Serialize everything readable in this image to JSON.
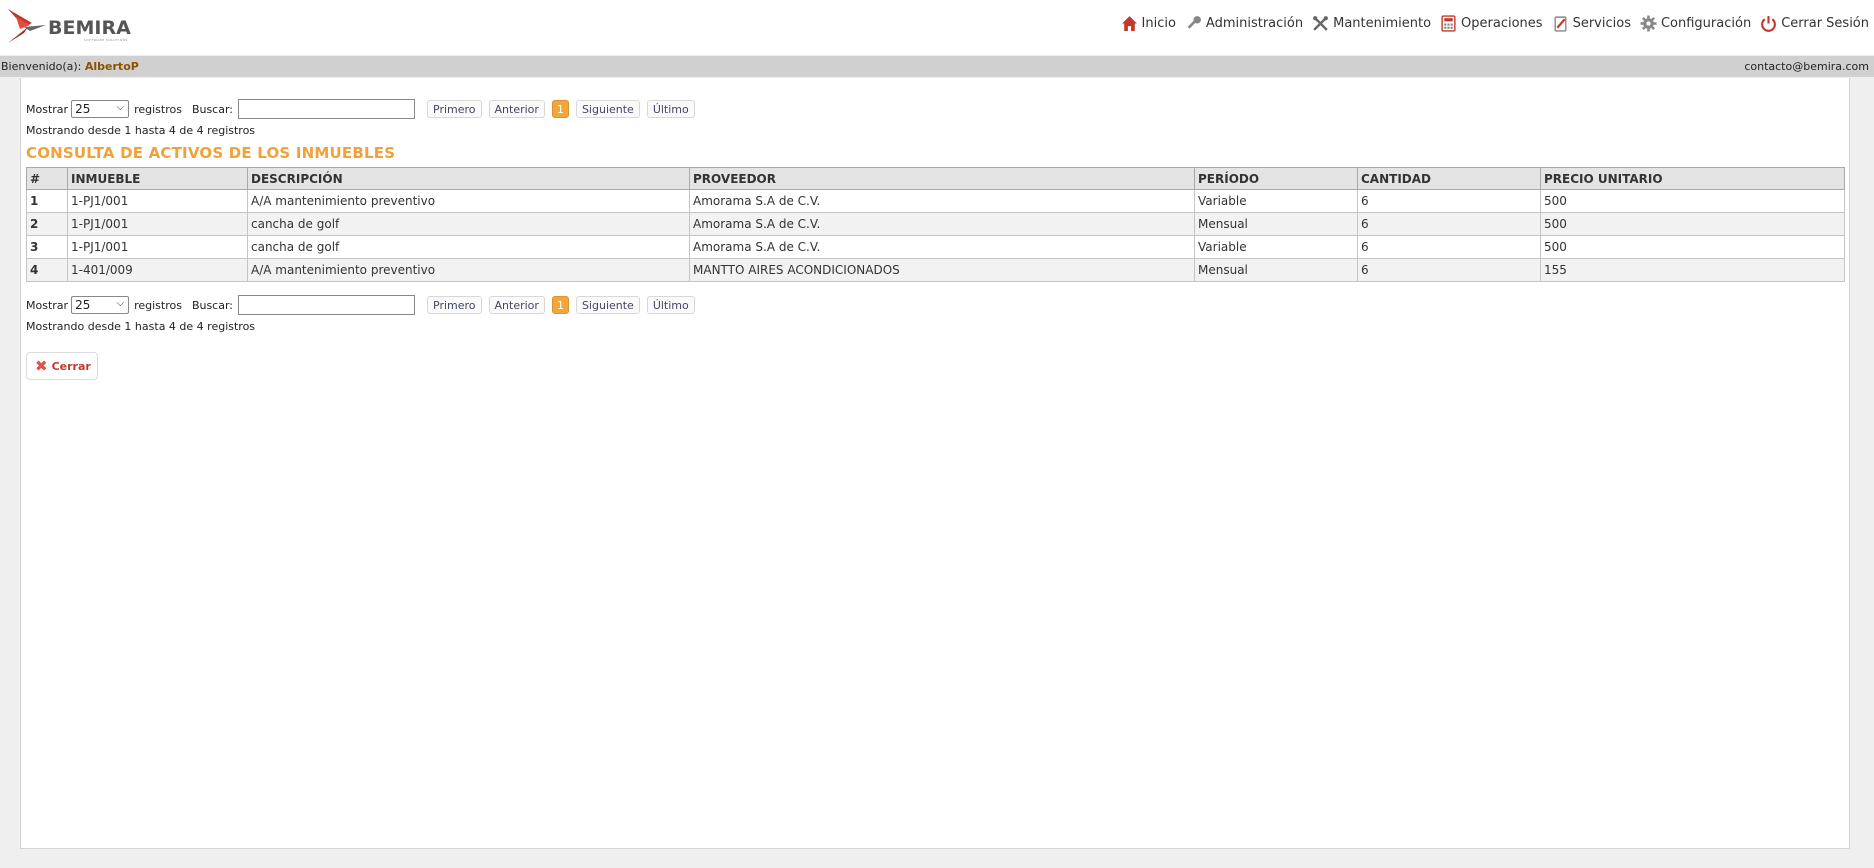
{
  "header": {
    "logo_text": "BEMIRA",
    "logo_sub": "SOFTWARE SOLUTIONS",
    "nav": [
      {
        "label": "Inicio",
        "icon": "home-icon"
      },
      {
        "label": "Administración",
        "icon": "key-icon"
      },
      {
        "label": "Mantenimiento",
        "icon": "tools-icon"
      },
      {
        "label": "Operaciones",
        "icon": "calculator-icon"
      },
      {
        "label": "Servicios",
        "icon": "clipboard-icon"
      },
      {
        "label": "Configuración",
        "icon": "gear-icon"
      },
      {
        "label": "Cerrar Sesión",
        "icon": "power-icon"
      }
    ]
  },
  "welcome": {
    "prefix": "Bienvenido(a):",
    "user": "AlbertoP",
    "email": "contacto@bemira.com"
  },
  "controls": {
    "show_label": "Mostrar",
    "page_size": "25",
    "records_label": "registros",
    "search_label": "Buscar:",
    "search_value": "",
    "first": "Primero",
    "prev": "Anterior",
    "page": "1",
    "next": "Siguiente",
    "last": "Último"
  },
  "info_text": "Mostrando desde 1 hasta 4 de 4 registros",
  "title": "CONSULTA DE ACTIVOS DE LOS INMUEBLES",
  "table": {
    "headers": [
      "#",
      "INMUEBLE",
      "DESCRIPCIÓN",
      "PROVEEDOR",
      "PERÍODO",
      "CANTIDAD",
      "PRECIO UNITARIO"
    ],
    "rows": [
      [
        "1",
        "1-PJ1/001",
        "A/A mantenimiento preventivo",
        "Amorama S.A de C.V.",
        "Variable",
        "6",
        "500"
      ],
      [
        "2",
        "1-PJ1/001",
        "cancha de golf",
        "Amorama S.A de C.V.",
        "Mensual",
        "6",
        "500"
      ],
      [
        "3",
        "1-PJ1/001",
        "cancha de golf",
        "Amorama S.A de C.V.",
        "Variable",
        "6",
        "500"
      ],
      [
        "4",
        "1-401/009",
        "A/A mantenimiento preventivo",
        "MANTTO AIRES ACONDICIONADOS",
        "Mensual",
        "6",
        "155"
      ]
    ]
  },
  "close_label": "Cerrar",
  "colors": {
    "accent": "#f0a13a",
    "welcome_bar": "#d0d0d0",
    "user_name": "#8a5400",
    "close": "#d9534f"
  }
}
